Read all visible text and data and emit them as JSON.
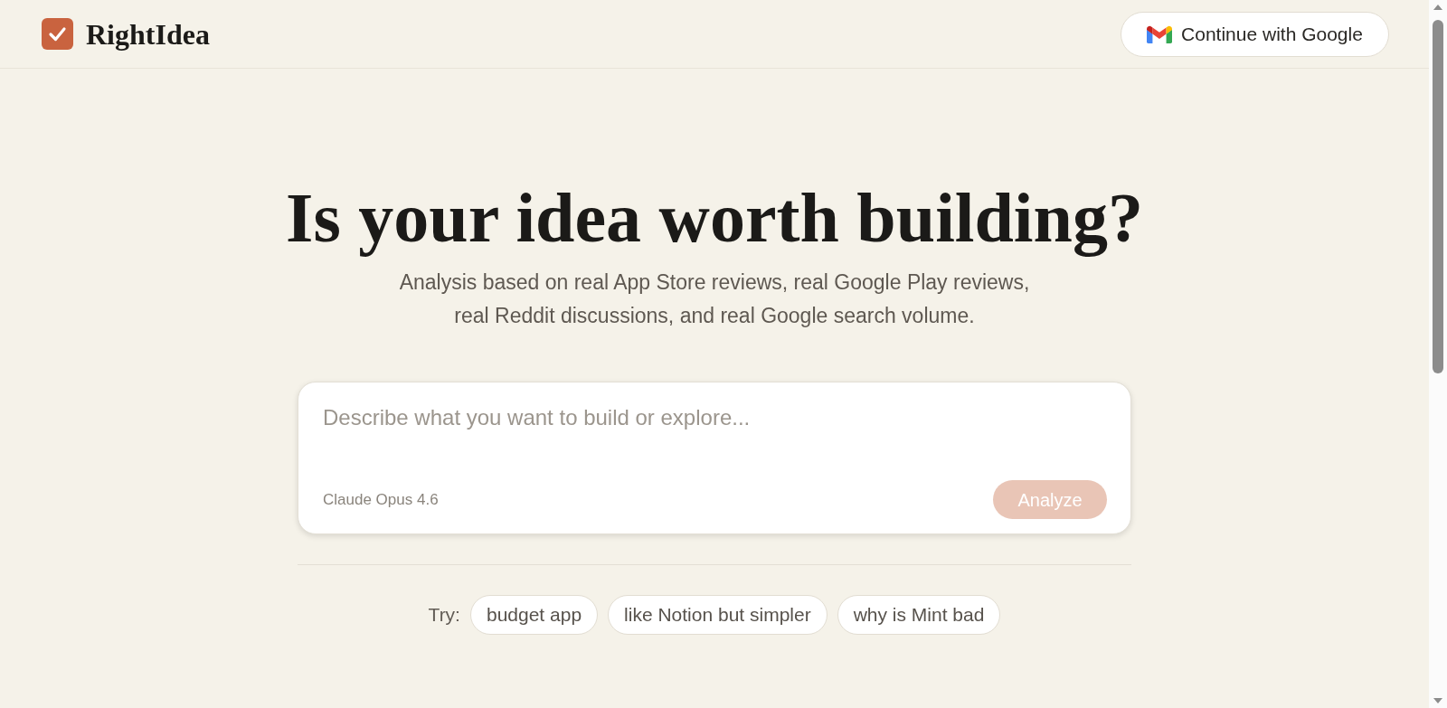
{
  "header": {
    "logo": {
      "text": "RightIdea"
    },
    "sign_in_button": {
      "label": "Continue with Google"
    }
  },
  "hero": {
    "title": "Is your idea worth building?",
    "subtitle_lines": [
      "Analysis based on real App Store reviews, real Google Play reviews,",
      "real Reddit discussions, and real Google search volume."
    ]
  },
  "prompt_box": {
    "placeholder": "Describe what you want to build or explore...",
    "model": "Claude Opus 4.6",
    "submit_button": {
      "label": "Analyze",
      "disabled": true
    }
  },
  "suggestions": {
    "label": "Try:",
    "chips": [
      "budget app",
      "like Notion but simpler",
      "why is Mint bad"
    ]
  }
}
